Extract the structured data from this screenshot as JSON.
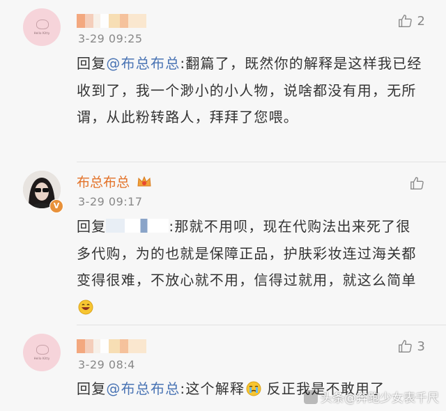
{
  "comments": [
    {
      "time": "3-29 09:25",
      "likes": "2",
      "reply_prefix": "回复",
      "mention": "@布总布总",
      "text": ":翻篇了，既然你的解释是这样我已经收到了，我一个渺小的小人物，说啥都没有用，无所谓，从此粉转路人，拜拜了您喂。",
      "avatar_caption": "Hello Kitty"
    },
    {
      "username": "布总布总",
      "time": "3-29 09:17",
      "reply_prefix": "回复",
      "text": ":那就不用呗，现在代购法出来死了很多代购，为的也就是保障正品，护肤彩妆连过海关都变得很难，不放心就不用，信得过就用，就这么简单",
      "verified_badge": "V",
      "avatar_icon": "user-avatar-sunglasses"
    },
    {
      "time": "3-29 08:4",
      "likes": "3",
      "reply_prefix": "回复",
      "mention": "@布总布总",
      "text": ":这个解释",
      "text_after": "反正我是不敢用了",
      "avatar_caption": "Hello Kitty"
    }
  ],
  "watermark": "头条@奔跑少女表千尺",
  "colors": {
    "mention": "#4a74b4",
    "username": "#e3732a",
    "meta": "#888888",
    "background": "#f7f7f7"
  }
}
